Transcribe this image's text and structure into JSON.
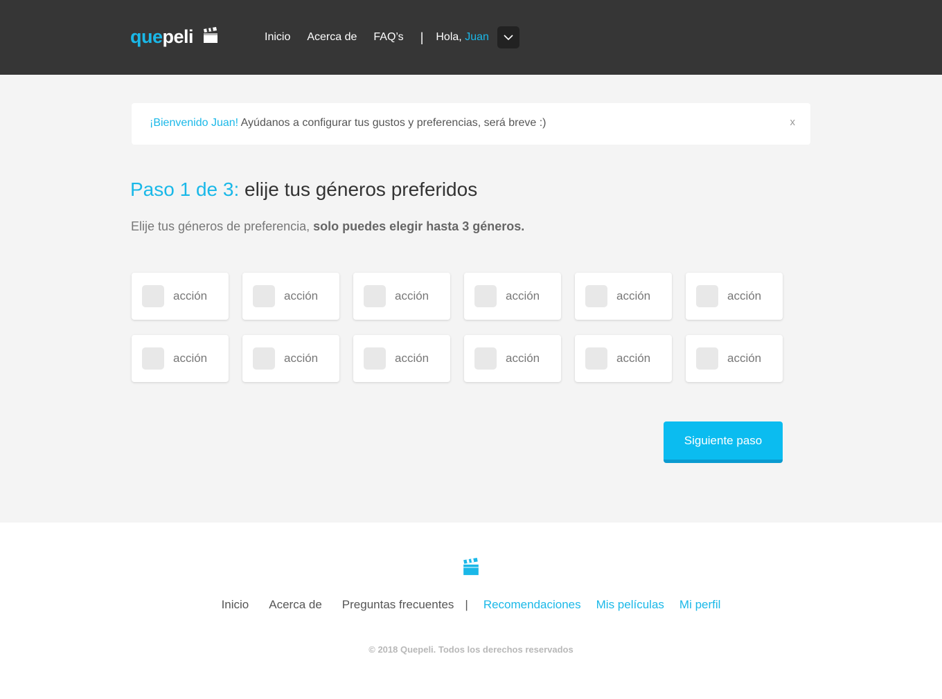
{
  "header": {
    "logo": {
      "part1": "que",
      "part2": "peli"
    },
    "nav": [
      "Inicio",
      "Acerca de",
      "FAQ’s"
    ],
    "greeting": "Hola,",
    "user_name": "Juan"
  },
  "alert": {
    "highlight": "¡Bienvenido Juan!",
    "message": " Ayúdanos a configurar tus gustos y preferencias, será breve :)",
    "close": "x"
  },
  "step": {
    "title_highlight": "Paso 1 de 3:",
    "title_rest": " elije tus géneros preferidos",
    "desc_plain": "Elije tus géneros de preferencia, ",
    "desc_bold": "solo puedes elegir hasta 3 géneros."
  },
  "genres": [
    "acción",
    "acción",
    "acción",
    "acción",
    "acción",
    "acción",
    "acción",
    "acción",
    "acción",
    "acción",
    "acción",
    "acción"
  ],
  "next_button": "Siguiente paso",
  "footer": {
    "nav_plain": [
      "Inicio",
      "Acerca de",
      "Preguntas frecuentes"
    ],
    "nav_user": [
      "Recomendaciones",
      "Mis películas",
      "Mi perfil"
    ],
    "copyright": "© 2018 Quepeli. Todos los derechos reservados"
  },
  "colors": {
    "accent": "#1ab8e8",
    "button": "#0bbcf0",
    "header_bg": "#363636"
  },
  "icons": [
    "clapperboard-icon",
    "chevron-down-icon"
  ]
}
